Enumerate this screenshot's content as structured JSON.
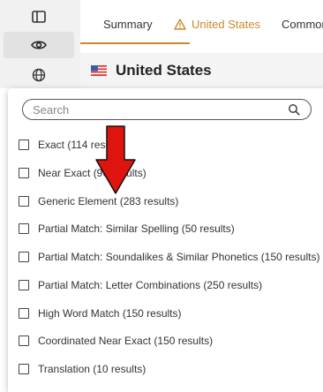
{
  "rail": {
    "items": [
      {
        "icon": "panel-icon",
        "active": false
      },
      {
        "icon": "eye-icon",
        "active": true
      },
      {
        "icon": "globe-icon",
        "active": false
      }
    ]
  },
  "tabs": [
    {
      "label": "Summary"
    },
    {
      "label": "United States",
      "icon": "warning-icon",
      "active": true
    },
    {
      "label": "Common"
    }
  ],
  "title": {
    "text": "United States",
    "icon": "us-flag-icon"
  },
  "search": {
    "placeholder": "Search",
    "value": ""
  },
  "options": [
    {
      "label": "Exact (114 results)",
      "checked": false
    },
    {
      "label": "Near Exact (96 results)",
      "checked": false
    },
    {
      "label": "Generic Element (283 results)",
      "checked": false
    },
    {
      "label": "Partial Match: Similar Spelling (50 results)",
      "checked": false
    },
    {
      "label": "Partial Match: Soundalikes & Similar Phonetics (150 results)",
      "checked": false
    },
    {
      "label": "Partial Match: Letter Combinations (250 results)",
      "checked": false
    },
    {
      "label": "High Word Match (150 results)",
      "checked": false
    },
    {
      "label": "Coordinated Near Exact (150 results)",
      "checked": false
    },
    {
      "label": "Translation (10 results)",
      "checked": false
    }
  ],
  "colors": {
    "accent": "#c98a2b",
    "arrow": "#e0140f",
    "rail_bg": "#f1f1f1"
  }
}
